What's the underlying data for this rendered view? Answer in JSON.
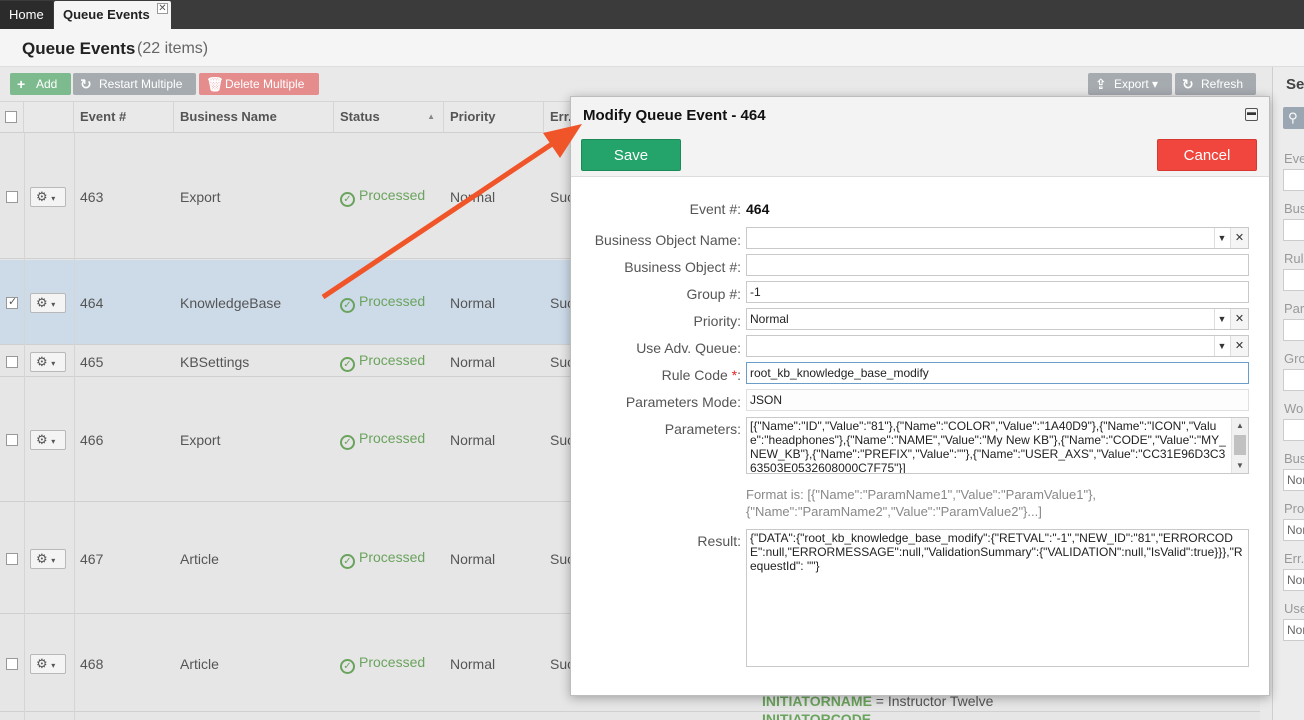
{
  "tabs": {
    "home": "Home",
    "active": "Queue Events"
  },
  "page": {
    "title": "Queue Events",
    "count": "(22 items)"
  },
  "toolbar": {
    "add": "Add",
    "restart": "Restart Multiple",
    "delete": "Delete Multiple",
    "export": "Export",
    "refresh": "Refresh"
  },
  "grid": {
    "columns": [
      "Event #",
      "Business Name",
      "Status",
      "Priority",
      "Err."
    ],
    "rows": [
      {
        "event": "463",
        "business": "Export",
        "status": "Processed",
        "priority": "Normal",
        "err": "Suc"
      },
      {
        "event": "464",
        "business": "KnowledgeBase",
        "status": "Processed",
        "priority": "Normal",
        "err": "Suc"
      },
      {
        "event": "465",
        "business": "KBSettings",
        "status": "Processed",
        "priority": "Normal",
        "err": "Suc"
      },
      {
        "event": "466",
        "business": "Export",
        "status": "Processed",
        "priority": "Normal",
        "err": "Suc"
      },
      {
        "event": "467",
        "business": "Article",
        "status": "Processed",
        "priority": "Normal",
        "err": "Suc"
      },
      {
        "event": "468",
        "business": "Article",
        "status": "Processed",
        "priority": "Normal",
        "err": "Suc"
      }
    ],
    "detail_line1_key": "INITIATORNAME",
    "detail_line1_val": " = Instructor Twelve",
    "detail_line2_key": "INITIATORCODE"
  },
  "search_panel": {
    "title": "Sea",
    "labels": [
      "Eve",
      "Bus",
      "Rul",
      "Par",
      "Gro",
      "Wo",
      "Bus",
      "Pro",
      "Err.",
      "Use"
    ],
    "selects": [
      "Nor",
      "Nor",
      "Nor",
      "Nor"
    ]
  },
  "modal": {
    "title": "Modify Queue Event - 464",
    "save": "Save",
    "cancel": "Cancel",
    "labels": {
      "event": "Event #:",
      "bo_name": "Business Object Name:",
      "bo_num": "Business Object #:",
      "group": "Group #:",
      "priority": "Priority:",
      "adv_queue": "Use Adv. Queue:",
      "rule_code": "Rule Code",
      "params_mode": "Parameters Mode:",
      "params": "Parameters:",
      "result": "Result:"
    },
    "values": {
      "event": "464",
      "bo_name": "",
      "bo_num": "",
      "group": "-1",
      "priority": "Normal",
      "adv_queue": "",
      "rule_code": "root_kb_knowledge_base_modify",
      "params_mode": "JSON",
      "params": "[{\"Name\":\"ID\",\"Value\":\"81\"},{\"Name\":\"COLOR\",\"Value\":\"1A40D9\"},{\"Name\":\"ICON\",\"Value\":\"headphones\"},{\"Name\":\"NAME\",\"Value\":\"My New KB\"},{\"Name\":\"CODE\",\"Value\":\"MY_NEW_KB\"},{\"Name\":\"PREFIX\",\"Value\":\"\"},{\"Name\":\"USER_AXS\",\"Value\":\"CC31E96D3C363503E0532608000C7F75\"}]",
      "format_hint": "Format is: [{\"Name\":\"ParamName1\",\"Value\":\"ParamValue1\"},{\"Name\":\"ParamName2\",\"Value\":\"ParamValue2\"}...]",
      "result": "{\"DATA\":{\"root_kb_knowledge_base_modify\":{\"RETVAL\":\"-1\",\"NEW_ID\":\"81\",\"ERRORCODE\":null,\"ERRORMESSAGE\":null,\"ValidationSummary\":{\"VALIDATION\":null,\"IsValid\":true}}},\"RequestId\": \"\"}"
    }
  },
  "colors": {
    "save": "#24a36a",
    "cancel": "#f0463d",
    "processed": "#6aa35d",
    "arrow": "#f0552a"
  }
}
